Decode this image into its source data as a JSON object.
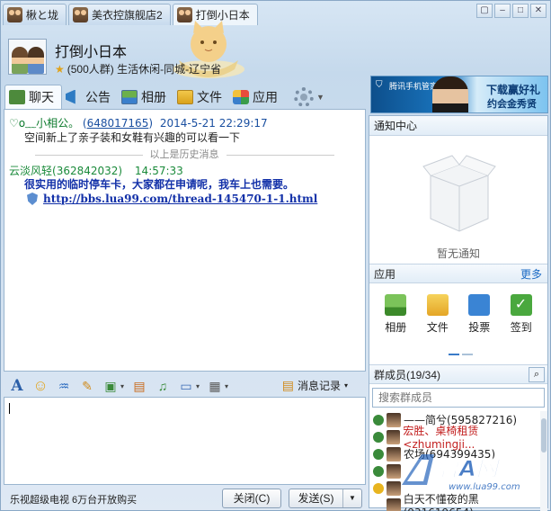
{
  "tabs": [
    {
      "label": "楸と垅"
    },
    {
      "label": "美衣控旗舰店2"
    },
    {
      "label": "打倒小日本"
    }
  ],
  "window_buttons": {
    "restore": "▢",
    "minimize": "–",
    "maximize": "□",
    "close": "✕"
  },
  "header": {
    "group_name": "打倒小日本",
    "group_info": "(500人群) 生活休闲-同城-辽宁省"
  },
  "ad": {
    "shield": "⛉",
    "guard": "腾讯手机管家",
    "line1": "下载赢好礼",
    "line2": "约会金秀贤"
  },
  "toolbar": {
    "chat": "聊天",
    "notice": "公告",
    "album": "相册",
    "file": "文件",
    "app": "应用",
    "caret": "▼"
  },
  "messages": [
    {
      "nick": "♡o﹏小相公。",
      "qq": "648017165",
      "time": "2014-5-21 22:29:17",
      "text": "空间新上了亲子装和女鞋有兴趣的可以看一下"
    },
    {
      "nick": "云淡风轻",
      "qq": "(362842032)",
      "time": "14:57:33",
      "text": "很实用的临时停车卡，大家都在申请呢，我车上也需要。",
      "link": "http://bbs.lua99.com/thread-145470-1-1.html"
    }
  ],
  "history_separator": "以上是历史消息",
  "input_toolbar": {
    "font": "A",
    "emoji": "☺",
    "shake": "♒",
    "doodle": "✎",
    "image": "▣",
    "caret": "▾",
    "note": "▤",
    "music": "♫",
    "screen": "▭",
    "remote": "▦",
    "record_label": "消息记录"
  },
  "bottom": {
    "promo": "乐视超级电视 6万台开放购买",
    "close_label": "关闭(C)",
    "send_label": "发送(S)",
    "send_caret": "▼"
  },
  "right_panel": {
    "notify_title": "通知中心",
    "no_notice": "暂无通知",
    "apps_title": "应用",
    "more": "更多",
    "apps": [
      {
        "label": "相册"
      },
      {
        "label": "文件"
      },
      {
        "label": "投票"
      },
      {
        "label": "签到"
      }
    ],
    "members_title": "群成员(19/34)",
    "search_placeholder": "搜索群成员",
    "search_icon": "⌕",
    "members": [
      {
        "name": "——简兮(595827216)",
        "red": false
      },
      {
        "name": "宏胜、桌椅租赁<zhumingji...",
        "red": true
      },
      {
        "name": "农场(694399435)",
        "red": false
      },
      {
        "name": "",
        "red": false
      },
      {
        "name": "",
        "red": false
      },
      {
        "name": "白天不懂夜的黑(931619654)",
        "red": false
      }
    ]
  },
  "watermark": {
    "logo": "鲁A网",
    "url": "www.lua99.com"
  }
}
